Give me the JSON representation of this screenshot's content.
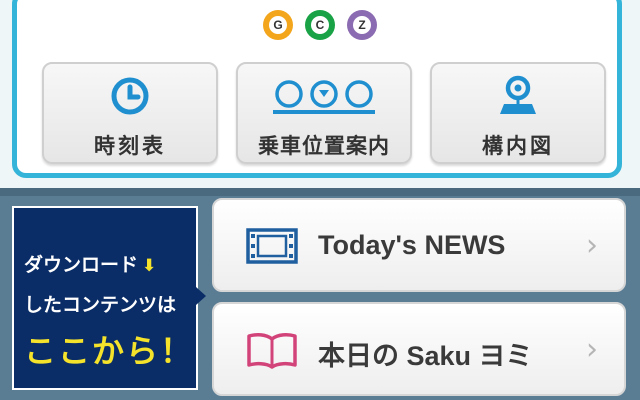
{
  "lines": [
    {
      "letter": "G",
      "color": "#f3a51c"
    },
    {
      "letter": "C",
      "color": "#1aa346"
    },
    {
      "letter": "Z",
      "color": "#8b6bb1"
    }
  ],
  "tiles": [
    {
      "label": "時刻表",
      "icon": "clock-icon"
    },
    {
      "label": "乗車位置案内",
      "icon": "boarding-position-icon"
    },
    {
      "label": "構内図",
      "icon": "station-map-icon"
    }
  ],
  "promo": {
    "line1": "ダウンロード",
    "line2": "したコンテンツは",
    "line3": "ここから！",
    "arrow_icon": "download-arrow-icon"
  },
  "cards": [
    {
      "label": "Today's NEWS",
      "icon": "film-icon"
    },
    {
      "label": "本日の Saku ヨミ",
      "icon": "book-icon"
    }
  ],
  "colors": {
    "accent_blue": "#1f8fd0",
    "panel_border": "#34b4d8",
    "promo_bg": "#0b2d67",
    "promo_highlight": "#f5e22a",
    "book_pink": "#d2437a"
  }
}
